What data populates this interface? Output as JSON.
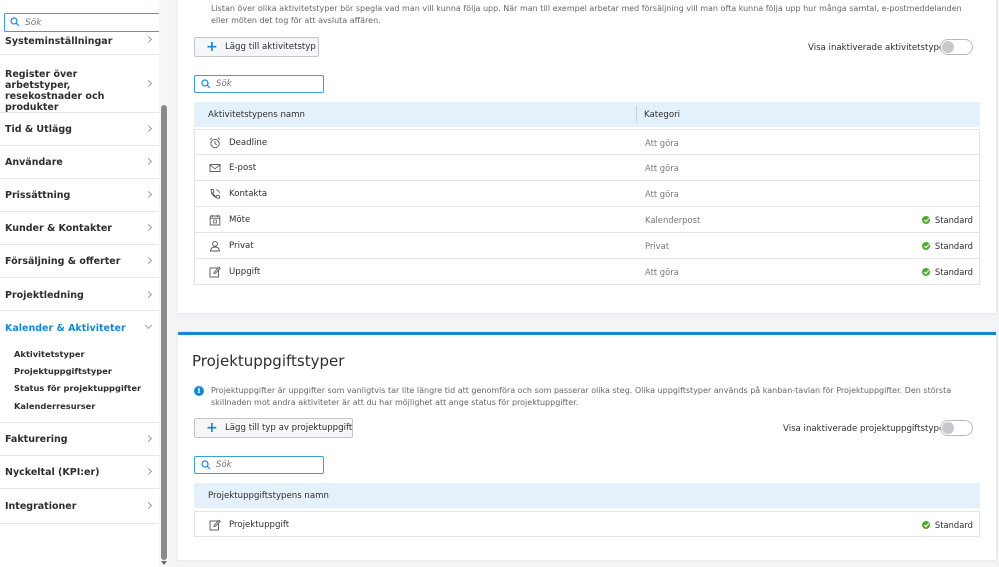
{
  "sidebar": {
    "search_placeholder": "Sök",
    "items": [
      {
        "label": "Systeminställningar"
      },
      {
        "label": "Register över arbetstyper, resekostnader och produkter"
      },
      {
        "label": "Tid & Utlägg"
      },
      {
        "label": "Användare"
      },
      {
        "label": "Prissättning"
      },
      {
        "label": "Kunder & Kontakter"
      },
      {
        "label": "Försäljning & offerter"
      },
      {
        "label": "Projektledning"
      },
      {
        "label": "Kalender & Aktiviteter"
      },
      {
        "label": "Fakturering"
      },
      {
        "label": "Nyckeltal (KPI:er)"
      },
      {
        "label": "Integrationer"
      }
    ],
    "subitems": [
      {
        "label": "Aktivitetstyper"
      },
      {
        "label": "Projektuppgiftstyper"
      },
      {
        "label": "Status för projektuppgifter"
      },
      {
        "label": "Kalenderresurser"
      }
    ]
  },
  "activity_types": {
    "description": "Listan över olika aktivitetstyper bör spegla vad man vill kunna följa upp. När man till exempel arbetar med försäljning vill man ofta kunna följa upp hur många samtal, e-postmeddelanden eller möten det tog för att avsluta affären.",
    "add_button": "Lägg till aktivitetstyp",
    "toggle_label": "Visa inaktiverade aktivitetstyper",
    "search_placeholder": "Sök",
    "columns": {
      "name": "Aktivitetstypens namn",
      "category": "Kategori"
    },
    "rows": [
      {
        "icon": "alarm-clock-icon",
        "name": "Deadline",
        "category": "Att göra",
        "standard": ""
      },
      {
        "icon": "envelope-icon",
        "name": "E-post",
        "category": "Att göra",
        "standard": ""
      },
      {
        "icon": "phone-icon",
        "name": "Kontakta",
        "category": "Att göra",
        "standard": ""
      },
      {
        "icon": "calendar-icon",
        "name": "Möte",
        "category": "Kalenderpost",
        "standard": "Standard"
      },
      {
        "icon": "person-icon",
        "name": "Privat",
        "category": "Privat",
        "standard": "Standard"
      },
      {
        "icon": "edit-icon",
        "name": "Uppgift",
        "category": "Att göra",
        "standard": "Standard"
      }
    ]
  },
  "project_task_types": {
    "title": "Projektuppgiftstyper",
    "description": "Projektuppgifter är uppgifter som vanligtvis tar lite längre tid att genomföra och som passerar olika steg. Olika uppgiftstyper används på kanban-tavlan för Projektuppgifter. Den största skillnaden mot andra aktiviteter är att du har möjlighet att ange status för projektuppgifter.",
    "add_button": "Lägg till typ av projektuppgift",
    "toggle_label": "Visa inaktiverade projektuppgiftstyper",
    "search_placeholder": "Sök",
    "columns": {
      "name": "Projektuppgiftstypens namn"
    },
    "rows": [
      {
        "icon": "edit-icon",
        "name": "Projektuppgift",
        "standard": "Standard"
      }
    ]
  },
  "colors": {
    "accent": "#1589cf",
    "standard_green": "#4ea832",
    "header_bg": "#e5f1fa"
  }
}
